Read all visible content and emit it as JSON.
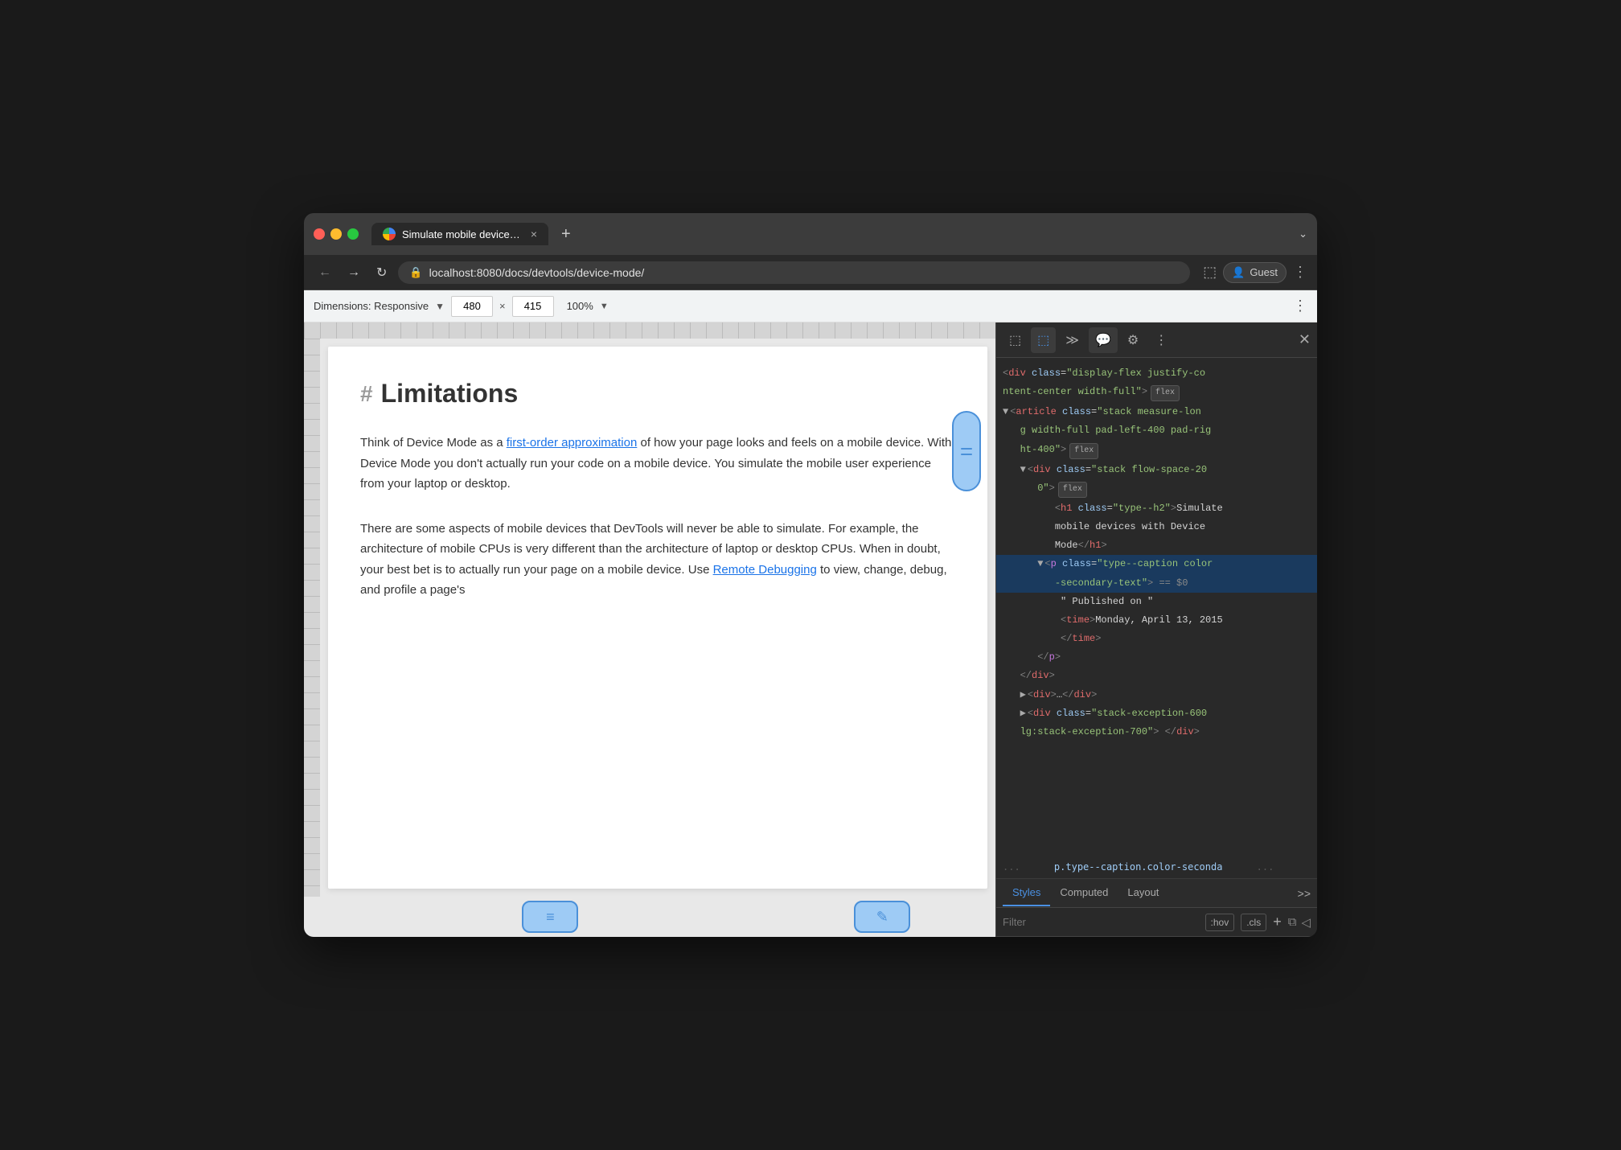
{
  "browser": {
    "tab_title": "Simulate mobile devices with D",
    "tab_close": "×",
    "tab_new": "+",
    "tab_menu_arrow": "⌄",
    "address": "localhost:8080/docs/devtools/device-mode/",
    "nav_back": "←",
    "nav_forward": "→",
    "nav_refresh": "↻",
    "guest_label": "Guest",
    "more_menu": "⋮"
  },
  "device_toolbar": {
    "dimensions_label": "Dimensions: Responsive",
    "width_value": "480",
    "height_value": "415",
    "zoom_value": "100%",
    "more": "⋮"
  },
  "page": {
    "hash": "#",
    "heading": "Limitations",
    "paragraph1": "Think of Device Mode as a first-order approximation of how your page looks and feels on a mobile device. With Device Mode you don't actually run your code on a mobile device. You simulate the mobile user experience from your laptop or desktop.",
    "paragraph1_link": "first-order approximation",
    "paragraph2": "There are some aspects of mobile devices that DevTools will never be able to simulate. For example, the architecture of mobile CPUs is very different than the architecture of laptop or desktop CPUs. When in doubt, your best bet is to actually run your page on a mobile device. Use Remote Debugging to view, change, debug, and profile a page's",
    "paragraph2_link1": "Remote",
    "paragraph2_link2": "Debugging"
  },
  "devtools": {
    "toolbar_buttons": [
      "☰",
      "⬚",
      "≫",
      "💬",
      "⚙",
      "⋮",
      "×"
    ],
    "html_lines": [
      {
        "indent": 0,
        "content": "<div class=\"display-flex justify-co",
        "badge": null,
        "expand": false
      },
      {
        "indent": 0,
        "content": "ntent-center width-full\">",
        "badge": "flex",
        "expand": false
      },
      {
        "indent": 0,
        "content": "<article class=\"stack measure-lon",
        "badge": null,
        "expand": true
      },
      {
        "indent": 2,
        "content": "g width-full pad-left-400 pad-rig",
        "badge": null,
        "expand": false
      },
      {
        "indent": 2,
        "content": "ht-400\">",
        "badge": "flex",
        "expand": false
      },
      {
        "indent": 2,
        "content": "<div class=\"stack flow-space-20",
        "badge": null,
        "expand": true
      },
      {
        "indent": 4,
        "content": "0\">",
        "badge": "flex",
        "expand": false
      },
      {
        "indent": 6,
        "content": "<h1 class=\"type--h2\">Simulate",
        "badge": null,
        "expand": false
      },
      {
        "indent": 6,
        "content": "mobile devices with Device",
        "badge": null,
        "expand": false
      },
      {
        "indent": 6,
        "content": "Mode</h1>",
        "badge": null,
        "expand": false
      },
      {
        "indent": 4,
        "content": "<p class=\"type--caption color",
        "badge": null,
        "expand": true,
        "selected": true
      },
      {
        "indent": 4,
        "content": "-secondary-text\">  == $0",
        "badge": null,
        "expand": false,
        "selected": true
      },
      {
        "indent": 6,
        "content": "\" Published on \"",
        "badge": null,
        "expand": false
      },
      {
        "indent": 6,
        "content": "<time>Monday, April 13, 2015",
        "badge": null,
        "expand": false
      },
      {
        "indent": 6,
        "content": "</time>",
        "badge": null,
        "expand": false
      },
      {
        "indent": 4,
        "content": "</p>",
        "badge": null,
        "expand": false
      },
      {
        "indent": 2,
        "content": "</div>",
        "badge": null,
        "expand": false
      },
      {
        "indent": 0,
        "content": "<div>…</div>",
        "badge": null,
        "expand": true
      },
      {
        "indent": 0,
        "content": "<div class=\"stack-exception-600",
        "badge": null,
        "expand": true
      },
      {
        "indent": 0,
        "content": "lg:stack-exception-700\"> </div>",
        "badge": null,
        "expand": false
      }
    ],
    "breadcrumb": "...    p.type--caption.color-seconda    ...",
    "styles_tabs": [
      "Styles",
      "Computed",
      "Layout",
      ">>"
    ],
    "filter_placeholder": "Filter",
    "filter_hov": ":hov",
    "filter_cls": ".cls"
  }
}
